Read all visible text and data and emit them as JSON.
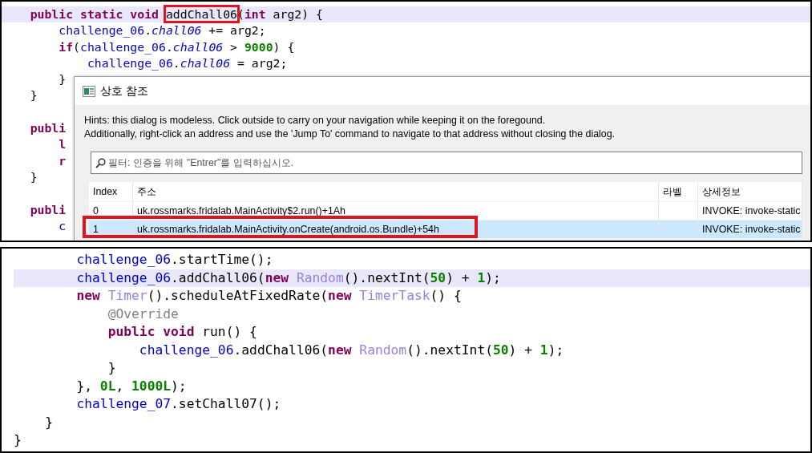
{
  "top_editor": {
    "lines": [
      {
        "highlighted": true,
        "tokens": [
          {
            "kind": "kw",
            "text": "    public static void "
          },
          {
            "kind": "plain",
            "text": "addChall06",
            "marked": true
          },
          {
            "kind": "plain",
            "text": "("
          },
          {
            "kind": "kw",
            "text": "int"
          },
          {
            "kind": "plain",
            "text": " arg2) {"
          }
        ]
      },
      {
        "highlighted": false,
        "tokens": [
          {
            "kind": "field",
            "text": "        challenge_06"
          },
          {
            "kind": "plain",
            "text": "."
          },
          {
            "kind": "sfield",
            "text": "chall06"
          },
          {
            "kind": "plain",
            "text": " += arg2;"
          }
        ]
      },
      {
        "highlighted": false,
        "tokens": [
          {
            "kind": "kw",
            "text": "        if"
          },
          {
            "kind": "plain",
            "text": "("
          },
          {
            "kind": "field",
            "text": "challenge_06"
          },
          {
            "kind": "plain",
            "text": "."
          },
          {
            "kind": "sfield",
            "text": "chall06"
          },
          {
            "kind": "plain",
            "text": " > "
          },
          {
            "kind": "num",
            "text": "9000"
          },
          {
            "kind": "plain",
            "text": ") {"
          }
        ]
      },
      {
        "highlighted": false,
        "tokens": [
          {
            "kind": "field",
            "text": "            challenge_06"
          },
          {
            "kind": "plain",
            "text": "."
          },
          {
            "kind": "sfield",
            "text": "chall06"
          },
          {
            "kind": "plain",
            "text": " = arg2;"
          }
        ]
      },
      {
        "highlighted": false,
        "tokens": [
          {
            "kind": "plain",
            "text": "        }"
          }
        ]
      },
      {
        "highlighted": false,
        "tokens": [
          {
            "kind": "plain",
            "text": "    }"
          }
        ]
      },
      {
        "highlighted": false
      },
      {
        "highlighted": false,
        "tokens": [
          {
            "kind": "kw",
            "text": "    publi"
          }
        ]
      },
      {
        "highlighted": false,
        "tokens": [
          {
            "kind": "kw",
            "text": "        l"
          }
        ]
      },
      {
        "highlighted": false,
        "tokens": [
          {
            "kind": "kw",
            "text": "        r"
          }
        ]
      },
      {
        "highlighted": false,
        "tokens": [
          {
            "kind": "plain",
            "text": "    }"
          }
        ]
      },
      {
        "highlighted": false
      },
      {
        "highlighted": false,
        "tokens": [
          {
            "kind": "kw",
            "text": "    publi"
          }
        ]
      },
      {
        "highlighted": false,
        "tokens": [
          {
            "kind": "field",
            "text": "        c"
          }
        ]
      }
    ]
  },
  "dialog": {
    "title": "상호 참조",
    "hints": [
      "Hints: this dialog is modeless. Click outside to carry on your navigation while keeping it on the foregound.",
      "Additionally, right-click an address and use the 'Jump To' command to navigate to that address without closing the dialog."
    ],
    "filter": {
      "placeholder": "필터: 인증을 위해 \"Entrer\"를 입력하십시오."
    },
    "table": {
      "columns": [
        "Index",
        "주소",
        "라벨",
        "상세정보"
      ],
      "rows": [
        {
          "selected": false,
          "marked": false,
          "cells": [
            "0",
            "uk.rossmarks.fridalab.MainActivity$2.run()+1Ah",
            "",
            "INVOKE: invoke-static"
          ]
        },
        {
          "selected": true,
          "marked": true,
          "cells": [
            "1",
            "uk.rossmarks.fridalab.MainActivity.onCreate(android.os.Bundle)+54h",
            "",
            "INVOKE: invoke-static"
          ]
        }
      ]
    }
  },
  "bottom_editor": {
    "lines": [
      {
        "highlighted": false,
        "tokens": [
          {
            "kind": "field",
            "text": "        challenge_06"
          },
          {
            "kind": "plain",
            "text": ".startTime();"
          }
        ]
      },
      {
        "highlighted": true,
        "tokens": [
          {
            "kind": "field",
            "text": "        challenge_06"
          },
          {
            "kind": "plain",
            "text": ".addChall06("
          },
          {
            "kind": "kw",
            "text": "new "
          },
          {
            "kind": "type",
            "text": "Random"
          },
          {
            "kind": "plain",
            "text": "().nextInt("
          },
          {
            "kind": "num",
            "text": "50"
          },
          {
            "kind": "plain",
            "text": ") + "
          },
          {
            "kind": "num",
            "text": "1"
          },
          {
            "kind": "plain",
            "text": ");"
          }
        ]
      },
      {
        "highlighted": false,
        "tokens": [
          {
            "kind": "kw",
            "text": "        new "
          },
          {
            "kind": "type",
            "text": "Timer"
          },
          {
            "kind": "plain",
            "text": "().scheduleAtFixedRate("
          },
          {
            "kind": "kw",
            "text": "new "
          },
          {
            "kind": "type",
            "text": "TimerTask"
          },
          {
            "kind": "plain",
            "text": "() {"
          }
        ]
      },
      {
        "highlighted": false,
        "tokens": [
          {
            "kind": "anno",
            "text": "            @Override"
          }
        ]
      },
      {
        "highlighted": false,
        "tokens": [
          {
            "kind": "kw",
            "text": "            public void"
          },
          {
            "kind": "plain",
            "text": " run() {"
          }
        ]
      },
      {
        "highlighted": false,
        "tokens": [
          {
            "kind": "field",
            "text": "                challenge_06"
          },
          {
            "kind": "plain",
            "text": ".addChall06("
          },
          {
            "kind": "kw",
            "text": "new "
          },
          {
            "kind": "type",
            "text": "Random"
          },
          {
            "kind": "plain",
            "text": "().nextInt("
          },
          {
            "kind": "num",
            "text": "50"
          },
          {
            "kind": "plain",
            "text": ") + "
          },
          {
            "kind": "num",
            "text": "1"
          },
          {
            "kind": "plain",
            "text": ");"
          }
        ]
      },
      {
        "highlighted": false,
        "tokens": [
          {
            "kind": "plain",
            "text": "            }"
          }
        ]
      },
      {
        "highlighted": false,
        "tokens": [
          {
            "kind": "plain",
            "text": "        }, "
          },
          {
            "kind": "num",
            "text": "0L"
          },
          {
            "kind": "plain",
            "text": ", "
          },
          {
            "kind": "num",
            "text": "1000L"
          },
          {
            "kind": "plain",
            "text": ");"
          }
        ]
      },
      {
        "highlighted": false,
        "tokens": [
          {
            "kind": "field",
            "text": "        challenge_07"
          },
          {
            "kind": "plain",
            "text": ".setChall07();"
          }
        ]
      },
      {
        "highlighted": false,
        "tokens": [
          {
            "kind": "plain",
            "text": "    }"
          }
        ]
      },
      {
        "highlighted": false,
        "tokens": [
          {
            "kind": "plain",
            "text": "}"
          }
        ]
      }
    ]
  }
}
